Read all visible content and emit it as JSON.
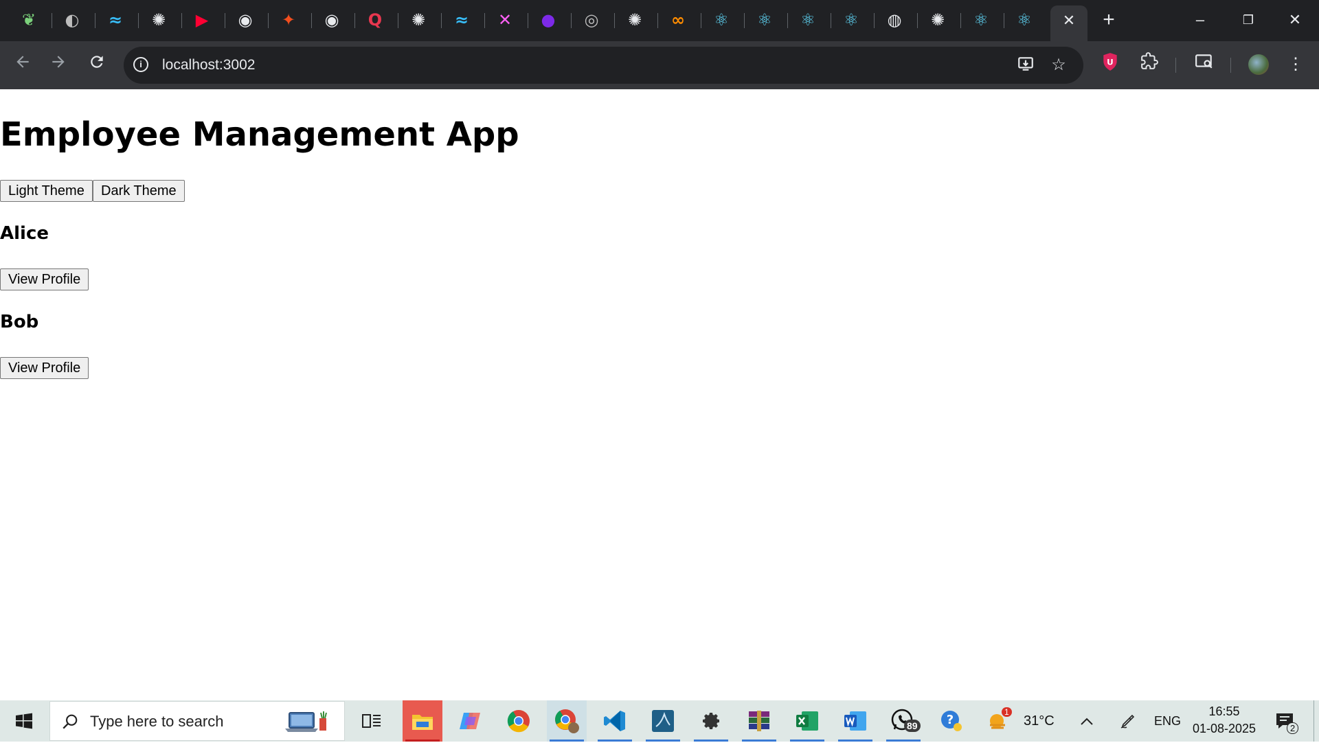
{
  "browser": {
    "url": "localhost:3002",
    "window_controls": {
      "minimize": "–",
      "restore": "❐",
      "close": "✕"
    },
    "new_tab_label": "+"
  },
  "tabs": [
    {
      "icon": "leaf-icon",
      "color": "#7bd17b"
    },
    {
      "icon": "globe-icon",
      "color": "#bdbdbd"
    },
    {
      "icon": "tailwind-icon",
      "color": "#38bdf8"
    },
    {
      "icon": "openai-icon",
      "color": "#e8eaed"
    },
    {
      "icon": "youtube-icon",
      "color": "#ff0033"
    },
    {
      "icon": "gpt-app-icon",
      "color": "#e8eaed"
    },
    {
      "icon": "figma-icon",
      "color": "#f24e1e"
    },
    {
      "icon": "gpt-app-icon",
      "color": "#e8eaed"
    },
    {
      "icon": "quora-icon",
      "color": "#e8374f"
    },
    {
      "icon": "openai-icon",
      "color": "#e8eaed"
    },
    {
      "icon": "tailwind-icon",
      "color": "#38bdf8"
    },
    {
      "icon": "xd-icon",
      "color": "#ff61f6"
    },
    {
      "icon": "canva-icon",
      "color": "#7d2ae8"
    },
    {
      "icon": "circle-logo-icon",
      "color": "#bdbdbd"
    },
    {
      "icon": "openai-icon",
      "color": "#e8eaed"
    },
    {
      "icon": "codepen-infinity-icon",
      "color": "#ff8c00"
    },
    {
      "icon": "react-icon",
      "color": "#61dafb"
    },
    {
      "icon": "react-icon",
      "color": "#61dafb"
    },
    {
      "icon": "react-icon",
      "color": "#61dafb"
    },
    {
      "icon": "react-icon",
      "color": "#61dafb"
    },
    {
      "icon": "chrome-icon",
      "color": "#e8eaed"
    },
    {
      "icon": "openai-icon",
      "color": "#e8eaed"
    },
    {
      "icon": "react-icon",
      "color": "#61dafb"
    },
    {
      "icon": "react-icon",
      "color": "#61dafb"
    }
  ],
  "app": {
    "title": "Employee Management App",
    "theme_buttons": {
      "light": "Light Theme",
      "dark": "Dark Theme"
    },
    "employees": [
      {
        "name": "Alice",
        "action": "View Profile"
      },
      {
        "name": "Bob",
        "action": "View Profile"
      }
    ]
  },
  "taskbar": {
    "search_placeholder": "Type here to search",
    "whatsapp_badge": "89",
    "weather_badge": "1",
    "temperature": "31°C",
    "language": "ENG",
    "time": "16:55",
    "date": "01-08-2025",
    "notification_count": "2"
  }
}
